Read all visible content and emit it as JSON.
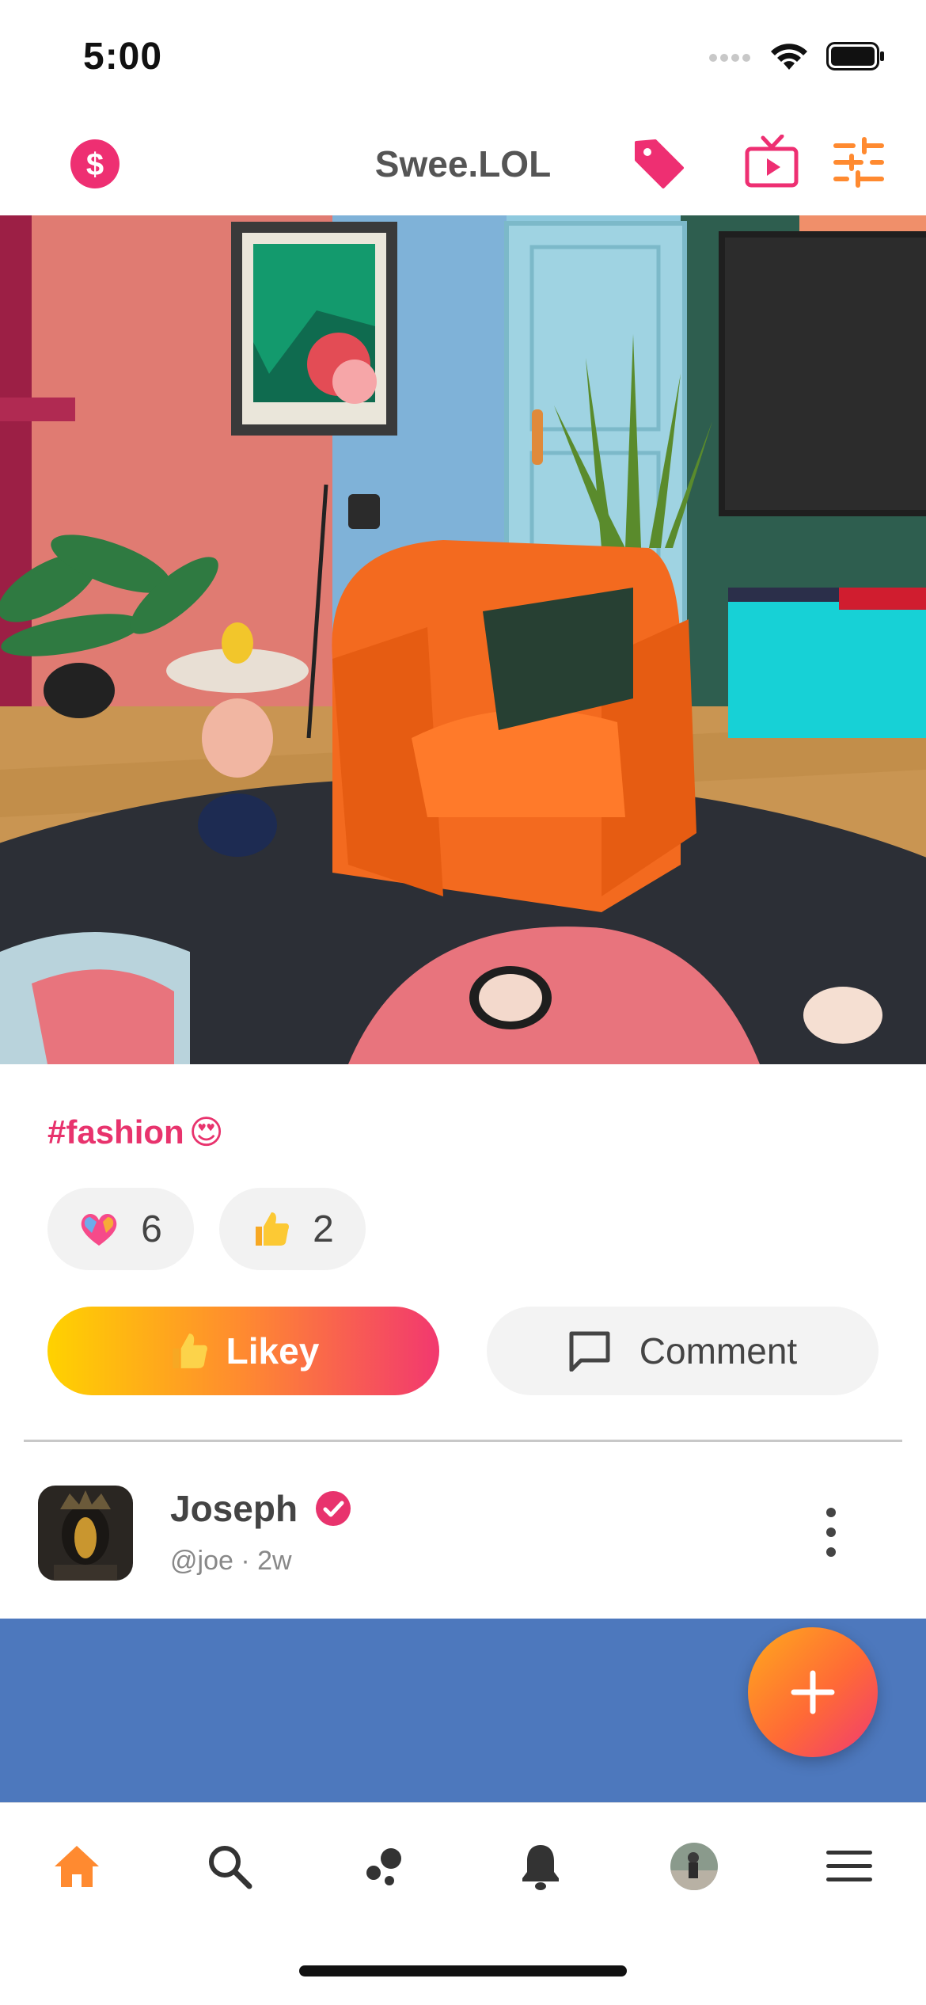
{
  "status_bar": {
    "time": "5:00"
  },
  "header": {
    "title": "Swee.LOL"
  },
  "post": {
    "hashtag": "#fashion",
    "hashtag_emoji": "😍",
    "reactions": [
      {
        "icon": "heart-reaction-icon",
        "count": "6"
      },
      {
        "icon": "thumbs-up-icon",
        "count": "2"
      }
    ],
    "like_label": "Likey",
    "comment_label": "Comment"
  },
  "next_post": {
    "author_name": "Joseph",
    "author_meta": "@joe · 2w"
  },
  "colors": {
    "accent_pink": "#e8336d",
    "accent_orange": "#ff8a30",
    "accent_yellow": "#ffd200"
  },
  "tabs": [
    {
      "name": "home",
      "active": true
    },
    {
      "name": "search",
      "active": false
    },
    {
      "name": "discover",
      "active": false
    },
    {
      "name": "notifications",
      "active": false
    },
    {
      "name": "profile",
      "active": false
    },
    {
      "name": "menu",
      "active": false
    }
  ]
}
